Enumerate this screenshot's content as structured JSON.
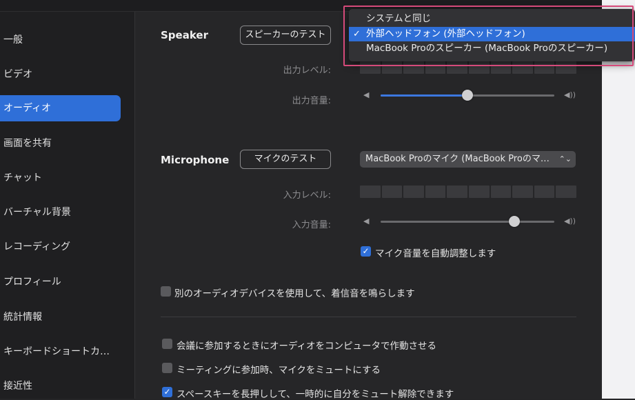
{
  "sidebar": {
    "items": [
      {
        "label": "一般"
      },
      {
        "label": "ビデオ"
      },
      {
        "label": "オーディオ"
      },
      {
        "label": "画面を共有"
      },
      {
        "label": "チャット"
      },
      {
        "label": "バーチャル背景"
      },
      {
        "label": "レコーディング"
      },
      {
        "label": "プロフィール"
      },
      {
        "label": "統計情報"
      },
      {
        "label": "キーボードショートカ…"
      },
      {
        "label": "接近性"
      }
    ],
    "active_index": 2
  },
  "speaker": {
    "section_label": "Speaker",
    "test_button": "スピーカーのテスト",
    "output_level_label": "出力レベル:",
    "output_volume_label": "出力音量:",
    "volume_value": 0.5
  },
  "speaker_dropdown": {
    "options": [
      {
        "label": "システムと同じ",
        "selected": false
      },
      {
        "label": "外部ヘッドフォン (外部ヘッドフォン)",
        "selected": true
      },
      {
        "label": "MacBook Proのスピーカー (MacBook Proのスピーカー)",
        "selected": false
      }
    ],
    "check_mark": "✓"
  },
  "microphone": {
    "section_label": "Microphone",
    "test_button": "マイクのテスト",
    "device_selected": "MacBook Proのマイク (MacBook Proのマ…",
    "input_level_label": "入力レベル:",
    "input_volume_label": "入力音量:",
    "volume_value": 0.77,
    "auto_adjust_label": "マイク音量を自動調整します",
    "auto_adjust_checked": true
  },
  "options": {
    "separate_ringtone_label": "別のオーディオデバイスを使用して、着信音を鳴らします",
    "separate_ringtone_checked": false,
    "join_computer_audio_label": "会議に参加するときにオーディオをコンピュータで作動させる",
    "join_computer_audio_checked": false,
    "mute_on_join_label": "ミーティングに参加時、マイクをミュートにする",
    "mute_on_join_checked": false,
    "space_unmute_label": "スペースキーを長押しして、一時的に自分をミュート解除できます",
    "space_unmute_checked": true
  },
  "icons": {
    "volume_low": "speaker-low-icon",
    "volume_high": "speaker-high-icon",
    "chevron": "updown-chevron-icon",
    "checkmark": "checkmark-icon"
  },
  "colors": {
    "accent": "#2f6fd8",
    "highlight_frame": "#d64a7a"
  }
}
